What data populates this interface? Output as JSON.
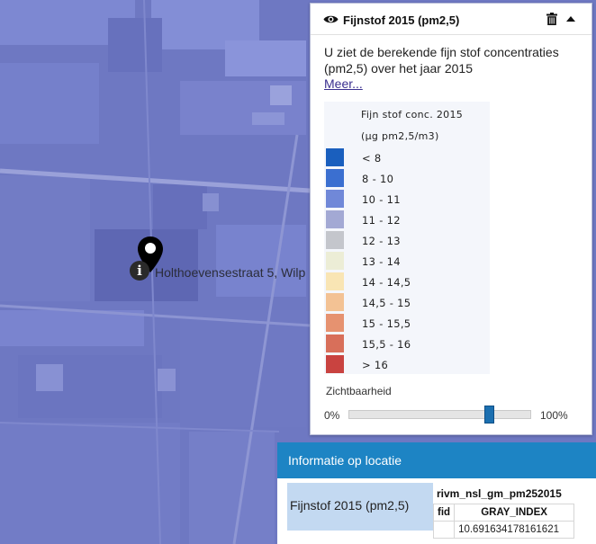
{
  "map": {
    "address_label": "Holthoevensestraat 5, Wilp",
    "marker_icon": "map-pin-icon",
    "info_icon_glyph": "i"
  },
  "layer_panel": {
    "title": "Fijnstof 2015 (pm2,5)",
    "description": "U ziet de berekende fijn stof concentraties (pm2,5) over het jaar 2015",
    "more_link": "Meer...",
    "icons": {
      "visibility": "eye-icon",
      "delete": "trash-icon",
      "collapse": "chevron-up-icon"
    },
    "legend": {
      "title": "Fijn stof conc. 2015",
      "unit": "(µg pm2,5/m3)",
      "items": [
        {
          "label": "< 8",
          "color": "#1a5fbe"
        },
        {
          "label": "8 - 10",
          "color": "#3b6fd0"
        },
        {
          "label": "10 - 11",
          "color": "#7088d8"
        },
        {
          "label": "11 - 12",
          "color": "#a3a9d4"
        },
        {
          "label": "12 - 13",
          "color": "#c4c6cc"
        },
        {
          "label": "13 - 14",
          "color": "#ecedd6"
        },
        {
          "label": "14 - 14,5",
          "color": "#f9e5b4"
        },
        {
          "label": "14,5 - 15",
          "color": "#f3c294"
        },
        {
          "label": "15 - 15,5",
          "color": "#e69270"
        },
        {
          "label": "15,5 - 16",
          "color": "#d86f5a"
        },
        {
          "label": "> 16",
          "color": "#c94340"
        }
      ]
    },
    "opacity": {
      "label": "Zichtbaarheid",
      "min_label": "0%",
      "max_label": "100%",
      "value": 0.79
    }
  },
  "info_panel": {
    "title": "Informatie op locatie",
    "layer_name": "Fijnstof 2015 (pm2,5)",
    "source": "rivm_nsl_gm_pm252015",
    "columns": [
      "fid",
      "GRAY_INDEX"
    ],
    "rows": [
      [
        "",
        "10.691634178161621"
      ]
    ]
  },
  "colors": {
    "accent": "#1d84c4",
    "slider_thumb": "#1b6fb0",
    "info_cell": "#c3d9f1"
  }
}
